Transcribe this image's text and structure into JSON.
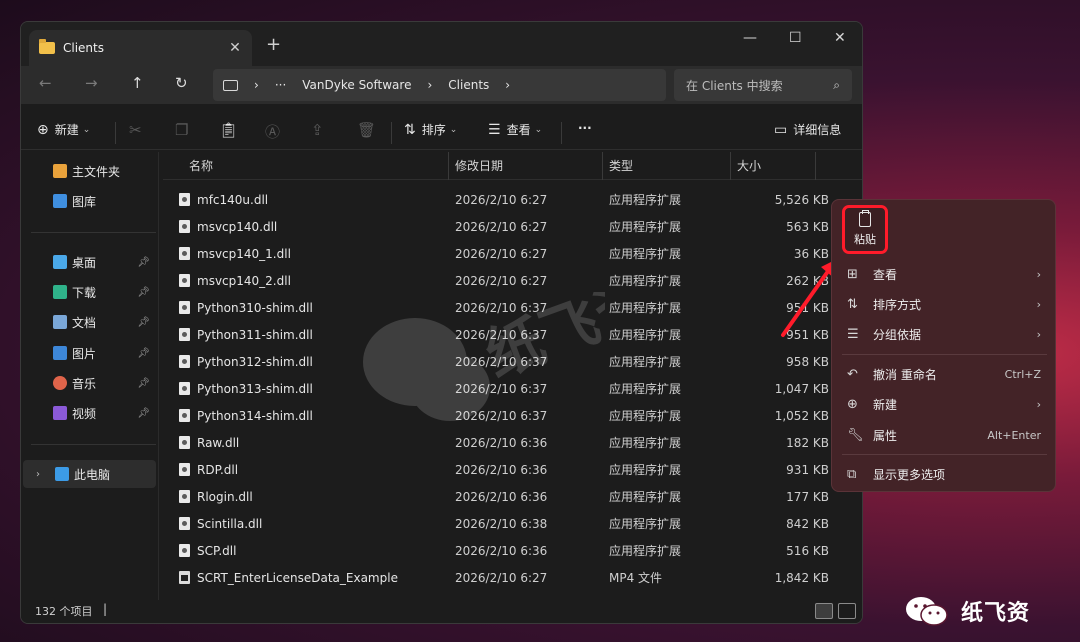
{
  "window": {
    "tab_label": "Clients",
    "new_tab": "+",
    "min": "—",
    "max": "☐",
    "close": "✕"
  },
  "nav": {
    "back": "←",
    "forward": "→",
    "up": "↑",
    "refresh": "↻",
    "breadcrumb": [
      "VanDyke Software",
      "Clients"
    ],
    "more": "···",
    "search_placeholder": "在 Clients 中搜索"
  },
  "toolbar": {
    "new_label": "新建",
    "sort_label": "排序",
    "view_label": "查看",
    "more": "···",
    "details_label": "详细信息"
  },
  "sidebar": {
    "home": "主文件夹",
    "gallery": "图库",
    "pinned": [
      "桌面",
      "下载",
      "文档",
      "图片",
      "音乐",
      "视频"
    ],
    "this_pc": "此电脑"
  },
  "columns": {
    "name": "名称",
    "date": "修改日期",
    "type": "类型",
    "size": "大小"
  },
  "files": [
    {
      "name": "mfc140u.dll",
      "date": "2026/2/10 6:27",
      "type": "应用程序扩展",
      "size": "5,526 KB"
    },
    {
      "name": "msvcp140.dll",
      "date": "2026/2/10 6:27",
      "type": "应用程序扩展",
      "size": "563 KB"
    },
    {
      "name": "msvcp140_1.dll",
      "date": "2026/2/10 6:27",
      "type": "应用程序扩展",
      "size": "36 KB"
    },
    {
      "name": "msvcp140_2.dll",
      "date": "2026/2/10 6:27",
      "type": "应用程序扩展",
      "size": "262 KB"
    },
    {
      "name": "Python310-shim.dll",
      "date": "2026/2/10 6:37",
      "type": "应用程序扩展",
      "size": "951 KB"
    },
    {
      "name": "Python311-shim.dll",
      "date": "2026/2/10 6:37",
      "type": "应用程序扩展",
      "size": "951 KB"
    },
    {
      "name": "Python312-shim.dll",
      "date": "2026/2/10 6:37",
      "type": "应用程序扩展",
      "size": "958 KB"
    },
    {
      "name": "Python313-shim.dll",
      "date": "2026/2/10 6:37",
      "type": "应用程序扩展",
      "size": "1,047 KB"
    },
    {
      "name": "Python314-shim.dll",
      "date": "2026/2/10 6:37",
      "type": "应用程序扩展",
      "size": "1,052 KB"
    },
    {
      "name": "Raw.dll",
      "date": "2026/2/10 6:36",
      "type": "应用程序扩展",
      "size": "182 KB"
    },
    {
      "name": "RDP.dll",
      "date": "2026/2/10 6:36",
      "type": "应用程序扩展",
      "size": "931 KB"
    },
    {
      "name": "Rlogin.dll",
      "date": "2026/2/10 6:36",
      "type": "应用程序扩展",
      "size": "177 KB"
    },
    {
      "name": "Scintilla.dll",
      "date": "2026/2/10 6:38",
      "type": "应用程序扩展",
      "size": "842 KB"
    },
    {
      "name": "SCP.dll",
      "date": "2026/2/10 6:36",
      "type": "应用程序扩展",
      "size": "516 KB"
    },
    {
      "name": "SCRT_EnterLicenseData_Example",
      "date": "2026/2/10 6:27",
      "type": "MP4 文件",
      "size": "1,842 KB"
    }
  ],
  "status": {
    "count": "132 个项目"
  },
  "context_menu": {
    "paste": "粘贴",
    "view": "查看",
    "sort": "排序方式",
    "group": "分组依据",
    "undo": "撤消 重命名",
    "undo_shortcut": "Ctrl+Z",
    "new": "新建",
    "properties": "属性",
    "properties_shortcut": "Alt+Enter",
    "more_options": "显示更多选项"
  },
  "brand": {
    "name": "纸飞资"
  },
  "colors": {
    "highlight": "#ff1b2a",
    "menu_bg": "#432327",
    "window_bg": "#1c1c1c"
  }
}
